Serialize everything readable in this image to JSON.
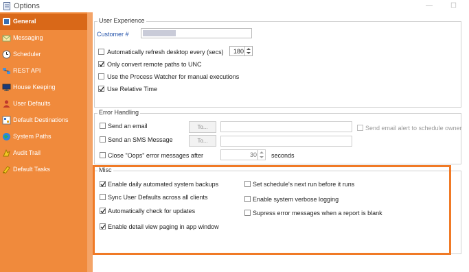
{
  "window": {
    "title": "Options"
  },
  "sidebar": {
    "items": [
      {
        "label": "General",
        "icon": "general-settings-icon"
      },
      {
        "label": "Messaging",
        "icon": "messaging-icon"
      },
      {
        "label": "Scheduler",
        "icon": "clock-icon"
      },
      {
        "label": "REST API",
        "icon": "network-icon"
      },
      {
        "label": "House Keeping",
        "icon": "monitor-icon"
      },
      {
        "label": "User Defaults",
        "icon": "user-icon"
      },
      {
        "label": "Default Destinations",
        "icon": "destinations-icon"
      },
      {
        "label": "System Paths",
        "icon": "globe-icon"
      },
      {
        "label": "Audit Trail",
        "icon": "audit-icon"
      },
      {
        "label": "Default Tasks",
        "icon": "tasks-icon"
      }
    ],
    "active": "General",
    "accent_color": "#f08a3c",
    "active_color": "#d96818"
  },
  "user_experience": {
    "title": "User Experience",
    "customer_label": "Customer #",
    "customer_value": "",
    "auto_refresh_label": "Automatically refresh desktop every (secs)",
    "auto_refresh_checked": false,
    "auto_refresh_value": "180",
    "unc_label": "Only convert remote paths to UNC",
    "unc_checked": true,
    "process_watcher_label": "Use the Process Watcher for manual executions",
    "process_watcher_checked": false,
    "relative_time_label": "Use Relative Time",
    "relative_time_checked": true
  },
  "error_handling": {
    "title": "Error Handling",
    "send_email_label": "Send an email",
    "send_email_checked": false,
    "send_sms_label": "Send an SMS Message",
    "send_sms_checked": false,
    "to_button_label": "To...",
    "to_button2_label": "To...",
    "schedule_owner_label": "Send email alert to schedule owner",
    "schedule_owner_checked": false,
    "close_oops_label": "Close \"Oops\" error messages after",
    "close_oops_checked": false,
    "close_oops_value": "30",
    "seconds_label": "seconds"
  },
  "misc": {
    "title": "Misc",
    "daily_backups_label": "Enable daily automated system backups",
    "daily_backups_checked": true,
    "sync_user_defaults_label": "Sync User Defaults across all clients",
    "sync_user_defaults_checked": false,
    "check_updates_label": "Automatically check for updates",
    "check_updates_checked": true,
    "detail_paging_label": "Enable detail view paging in app window",
    "detail_paging_checked": true,
    "next_run_label": "Set schedule's next run before it runs",
    "next_run_checked": false,
    "verbose_logging_label": "Enable system verbose logging",
    "verbose_logging_checked": false,
    "suppress_errors_label": "Supress error messages when a report is blank",
    "suppress_errors_checked": false,
    "highlight_color": "#f07a26"
  }
}
